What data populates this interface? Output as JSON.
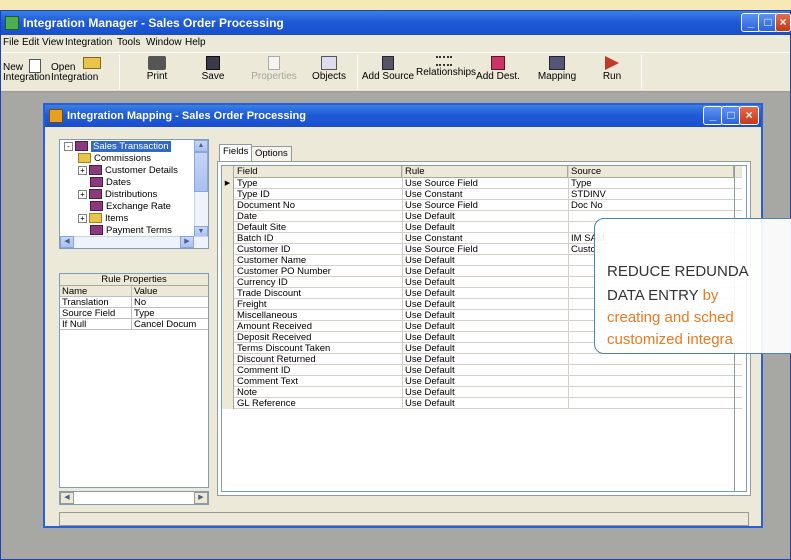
{
  "outer_window": {
    "title": "Integration Manager - Sales Order Processing"
  },
  "menu": [
    "File",
    "Edit",
    "View",
    "Integration",
    "Tools",
    "Window",
    "Help"
  ],
  "toolbar": [
    {
      "label": "New\nIntegration",
      "icon": "new-doc-icon",
      "enabled": true
    },
    {
      "label": "Open\nIntegration",
      "icon": "open-folder-icon",
      "enabled": true
    },
    {
      "label": "Print",
      "icon": "printer-icon",
      "enabled": true
    },
    {
      "label": "Save",
      "icon": "save-disk-icon",
      "enabled": true
    },
    {
      "label": "Properties",
      "icon": "properties-icon",
      "enabled": false
    },
    {
      "label": "Objects",
      "icon": "objects-icon",
      "enabled": true
    },
    {
      "label": "Add Source",
      "icon": "add-source-icon",
      "enabled": true
    },
    {
      "label": "Relationships",
      "icon": "relationships-icon",
      "enabled": true
    },
    {
      "label": "Add Dest.",
      "icon": "add-destination-icon",
      "enabled": true
    },
    {
      "label": "Mapping",
      "icon": "mapping-icon",
      "enabled": true
    },
    {
      "label": "Run",
      "icon": "run-arrow-icon",
      "enabled": true
    }
  ],
  "inner_window": {
    "title": "Integration Mapping - Sales Order Processing"
  },
  "tree": [
    {
      "label": "Sales Transaction",
      "expander": "-",
      "icon": "book",
      "selected": true
    },
    {
      "label": "Commissions",
      "expander": "",
      "icon": "folder",
      "selected": false
    },
    {
      "label": "Customer Details",
      "expander": "+",
      "icon": "book",
      "selected": false
    },
    {
      "label": "Dates",
      "expander": "",
      "icon": "book",
      "selected": false
    },
    {
      "label": "Distributions",
      "expander": "+",
      "icon": "book",
      "selected": false
    },
    {
      "label": "Exchange Rate",
      "expander": "",
      "icon": "book",
      "selected": false
    },
    {
      "label": "Items",
      "expander": "+",
      "icon": "folder",
      "selected": false
    },
    {
      "label": "Payment Terms",
      "expander": "",
      "icon": "book",
      "selected": false
    }
  ],
  "rule_properties": {
    "title": "Rule Properties",
    "headers": [
      "Name",
      "Value"
    ],
    "rows": [
      [
        "Translation",
        "No"
      ],
      [
        "Source Field",
        "Type"
      ],
      [
        "If Null",
        "Cancel Docum"
      ]
    ]
  },
  "tabs": [
    "Fields",
    "Options"
  ],
  "grid": {
    "headers": [
      "Field",
      "Rule",
      "Source"
    ],
    "rows": [
      [
        "Type",
        "Use Source Field",
        "Type"
      ],
      [
        "Type ID",
        "Use Constant",
        "STDINV"
      ],
      [
        "Document No",
        "Use Source Field",
        "Doc No"
      ],
      [
        "Date",
        "Use Default",
        ""
      ],
      [
        "Default Site",
        "Use Default",
        ""
      ],
      [
        "Batch ID",
        "Use Constant",
        "IM SAM"
      ],
      [
        "Customer ID",
        "Use Source Field",
        "Custo"
      ],
      [
        "Customer Name",
        "Use Default",
        ""
      ],
      [
        "Customer PO Number",
        "Use Default",
        ""
      ],
      [
        "Currency ID",
        "Use Default",
        ""
      ],
      [
        "Trade Discount",
        "Use Default",
        ""
      ],
      [
        "Freight",
        "Use Default",
        ""
      ],
      [
        "Miscellaneous",
        "Use Default",
        ""
      ],
      [
        "Amount Received",
        "Use Default",
        ""
      ],
      [
        "Deposit Received",
        "Use Default",
        ""
      ],
      [
        "Terms Discount Taken",
        "Use Default",
        ""
      ],
      [
        "Discount Returned",
        "Use Default",
        ""
      ],
      [
        "Comment ID",
        "Use Default",
        ""
      ],
      [
        "Comment Text",
        "Use Default",
        ""
      ],
      [
        "Note",
        "Use Default",
        ""
      ],
      [
        "GL Reference",
        "Use Default",
        ""
      ]
    ]
  },
  "callout": {
    "line1": "REDUCE REDUNDA",
    "line2_dark": "DATA ENTRY",
    "line2_orange": " by",
    "line3": "creating and sched",
    "line4": "customized integra"
  },
  "colors": {
    "title_bar": "#1f5bd7",
    "callout_orange": "#e87a22",
    "selection": "#316ac5",
    "background": "#f6e9b5"
  }
}
